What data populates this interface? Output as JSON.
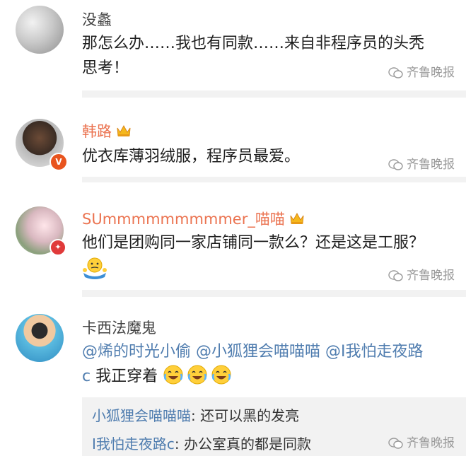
{
  "watermark": "齐鲁晚报",
  "comments": [
    {
      "name": "没蠡",
      "text_lines": [
        "那怎么办……我也有同款……来自非程序员的头秃",
        "思考！"
      ]
    },
    {
      "name": "韩路",
      "text_lines": [
        "优衣库薄羽绒服，程序员最爱。"
      ]
    },
    {
      "name": "SUmmmmmmmmmer_喵喵",
      "text_lines": [
        "他们是团购同一家店铺同一款么？还是这是工服？"
      ]
    },
    {
      "name": "卡西法魔鬼",
      "mention_line1": "@烯的时光小偷 @小狐狸会喵喵喵 @I我怕走夜路",
      "mention_line2_prefix": "c",
      "line2_text": "我正穿着",
      "replies": [
        {
          "name": "小狐狸会喵喵喵",
          "text": ": 还可以黑的发亮"
        },
        {
          "name": "I我怕走夜路c",
          "text": ": 办公室真的都是同款"
        }
      ]
    }
  ],
  "icons": {
    "crown": "crown-icon",
    "verified": "verified-badge-icon",
    "shrug": "shrug-emoji-icon",
    "laugh": "laugh-cry-emoji-icon",
    "wechat": "wechat-logo-icon"
  },
  "colors": {
    "mention": "#507daf",
    "vip_name": "#eb7350",
    "divider": "#f2f2f2",
    "watermark": "#9a9a9a"
  }
}
